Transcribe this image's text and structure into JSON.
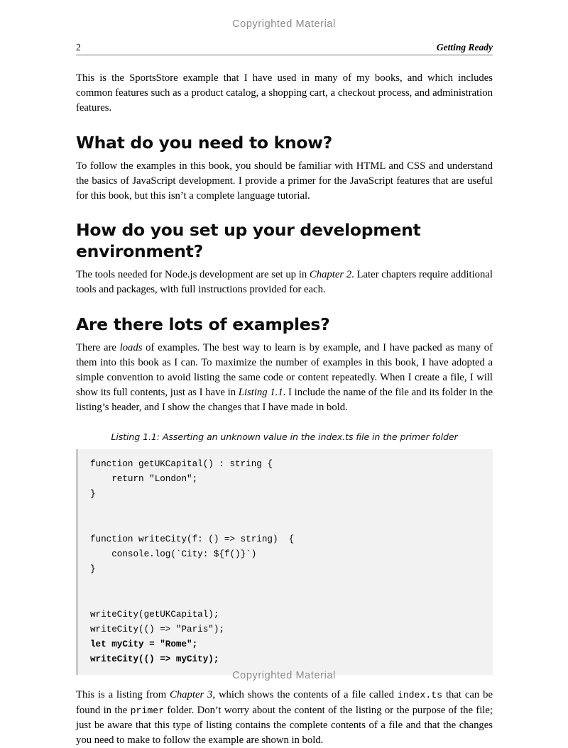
{
  "page": {
    "watermark_top": "Copyrighted Material",
    "watermark_bottom": "Copyrighted Material",
    "folio": "2",
    "running_head": "Getting Ready"
  },
  "intro": {
    "paragraph": "This is the SportsStore example that I have used in many of my books, and which includes common features such as a product catalog, a shopping cart, a checkout process, and administration features."
  },
  "sections": [
    {
      "heading": "What do you need to know?",
      "paragraph_1": "To follow the examples in this book, you should be familiar with HTML and CSS and understand the basics of JavaScript development. I provide a primer for the JavaScript features that are useful for this book, but this isn’t a complete language tutorial."
    },
    {
      "heading": "How do you set up your development environment?",
      "para_pre": "The tools needed for Node.js development are set up in ",
      "para_em": "Chapter 2",
      "para_post": ". Later chapters require additional tools and packages, with full instructions provided for each."
    },
    {
      "heading": "Are there lots of examples?",
      "para_a_pre": "There are ",
      "para_a_em1": "loads",
      "para_a_mid": " of examples. The best way to learn is by example, and I have packed as many of them into this book as I can. To maximize the number of examples in this book, I have adopted a simple convention to avoid listing the same code or content repeatedly. When I create a file, I will show its full contents, just as I have in ",
      "para_a_em2": "Listing 1.1",
      "para_a_post": ". I include the name of the file and its folder in the listing’s header, and I show the changes that I have made in bold."
    }
  ],
  "listing": {
    "caption": "Listing 1.1: Asserting an unknown value in the index.ts file in the primer folder",
    "background_color": "#f2f2f2",
    "border_color": "#c9c9c9",
    "code_plain": "function getUKCapital() : string {\n    return \"London\";\n}\n\n\nfunction writeCity(f: () => string)  {\n    console.log(`City: ${f()}`)\n}\n\n\nwriteCity(getUKCapital);\nwriteCity(() => \"Paris\");",
    "code_bold": "let myCity = \"Rome\";\nwriteCity(() => myCity);"
  },
  "closing": {
    "pre": "This is a listing from ",
    "em1": "Chapter 3",
    "mid1": ", which shows the contents of a file called ",
    "mono1": "index.ts",
    "mid2": " that can be found in the ",
    "mono2": "primer",
    "post": " folder. Don’t worry about the content of the listing or the purpose of the file; just be aware that this type of listing contains the complete contents of a file and that the changes you need to make to follow the example are shown in bold."
  }
}
